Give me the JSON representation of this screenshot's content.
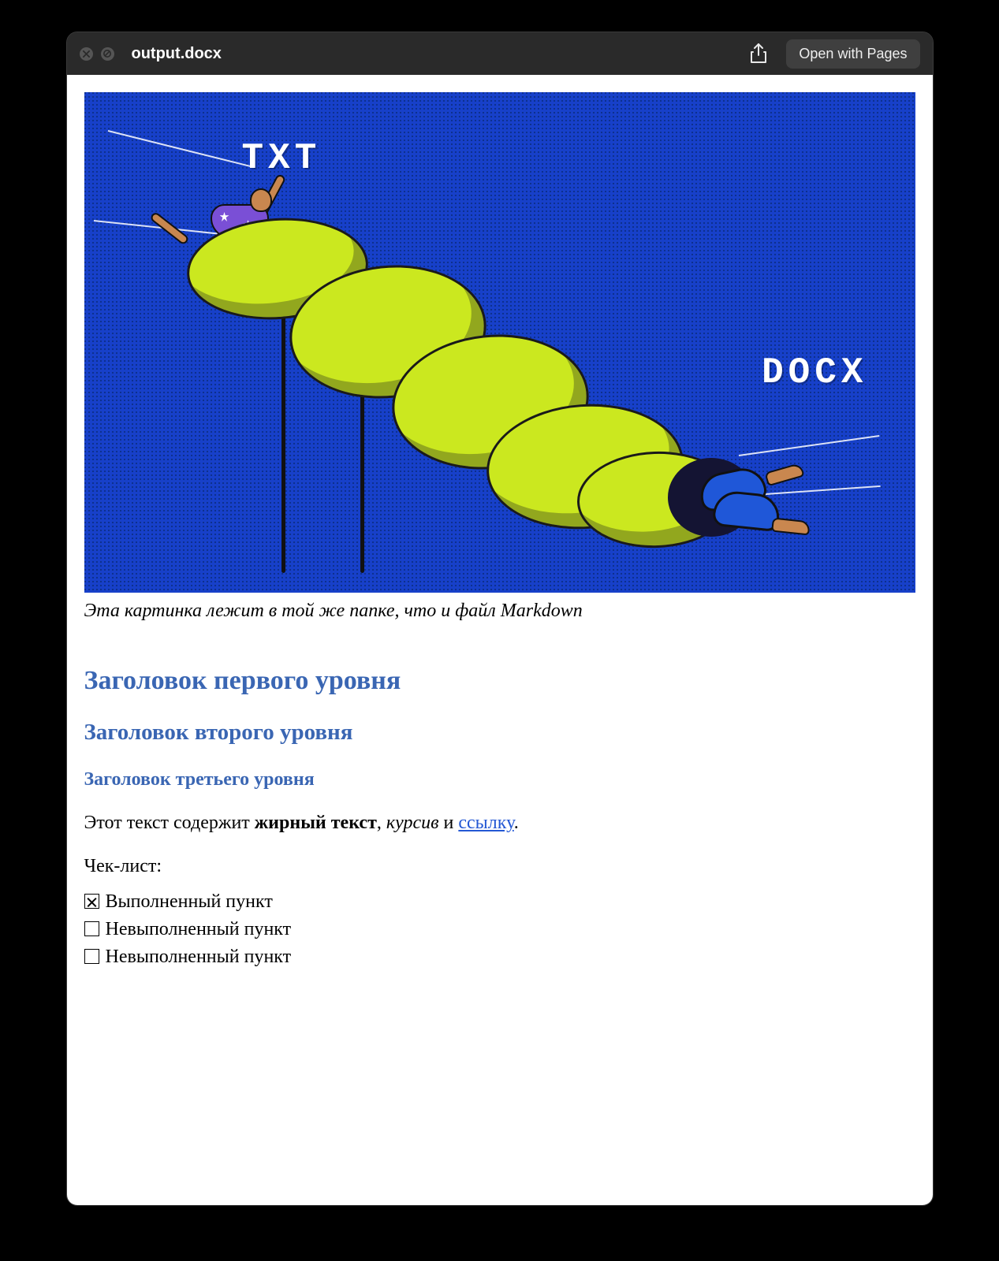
{
  "titlebar": {
    "filename": "output.docx",
    "open_with_label": "Open with Pages"
  },
  "hero": {
    "label_top": "TXT",
    "label_bottom": "DOCX"
  },
  "caption": "Эта картинка лежит в той же папке, что и файл Markdown",
  "headings": {
    "h1": "Заголовок первого уровня",
    "h2": "Заголовок второго уровня",
    "h3": "Заголовок третьего уровня"
  },
  "paragraph": {
    "prefix": "Этот текст содержит ",
    "bold": "жирный текст",
    "sep1": ", ",
    "italic": "курсив",
    "sep2": " и ",
    "link": "ссылку",
    "suffix": "."
  },
  "checklist": {
    "title": "Чек-лист:",
    "items": [
      {
        "checked": true,
        "label": "Выполненный пункт"
      },
      {
        "checked": false,
        "label": "Невыполненный пункт"
      },
      {
        "checked": false,
        "label": "Невыполненный пункт"
      }
    ]
  }
}
